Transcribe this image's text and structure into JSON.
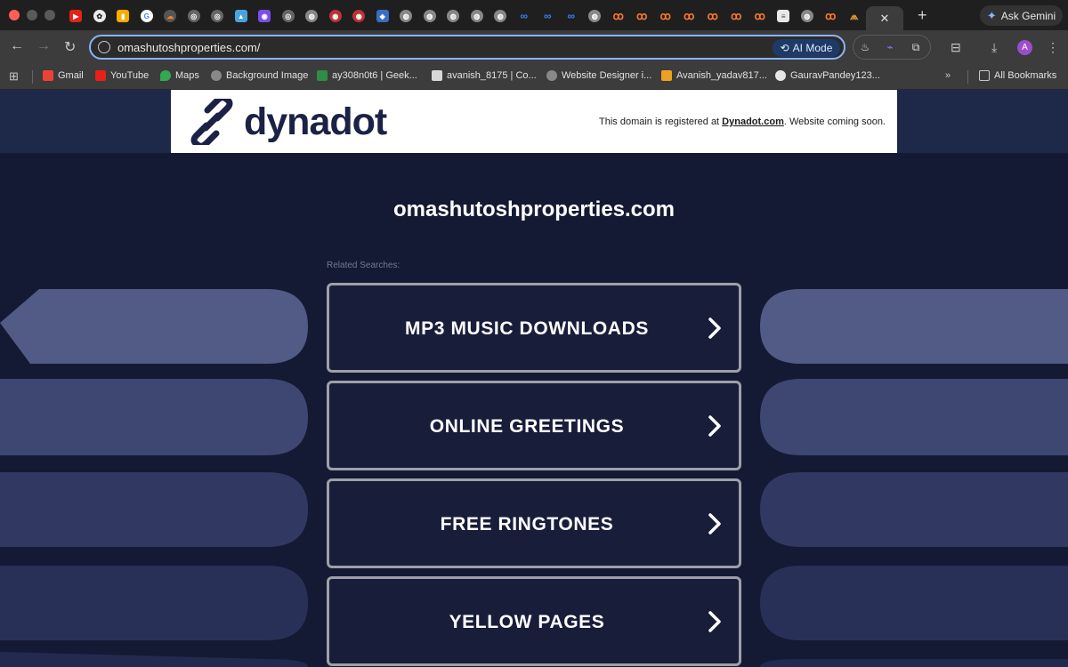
{
  "browser": {
    "url": "omashutoshproperties.com/",
    "ai_mode_label": "AI Mode",
    "gemini_label": "Ask Gemini",
    "avatar_initial": "A",
    "bookmarks": [
      {
        "label": "Gmail",
        "icon": "gmail-icon"
      },
      {
        "label": "YouTube",
        "icon": "youtube-icon"
      },
      {
        "label": "Maps",
        "icon": "maps-icon"
      },
      {
        "label": "Background Image",
        "icon": "globe-icon"
      },
      {
        "label": "ay308n0t6 | Geek...",
        "icon": "geeksforgeeks-icon"
      },
      {
        "label": "avanish_8175 | Co...",
        "icon": "codechef-icon"
      },
      {
        "label": "Website Designer i...",
        "icon": "globe-icon"
      },
      {
        "label": "Avanish_yadav817...",
        "icon": "leetcode-icon"
      },
      {
        "label": "GauravPandey123...",
        "icon": "github-icon"
      }
    ],
    "all_bookmarks_label": "All Bookmarks"
  },
  "page": {
    "brand_name": "dynadot",
    "notice_prefix": "This domain is registered at ",
    "notice_link": "Dynadot.com",
    "notice_suffix": ". Website coming soon.",
    "domain": "omashutoshproperties.com",
    "related_label": "Related Searches:",
    "searches": [
      "MP3 MUSIC DOWNLOADS",
      "ONLINE GREETINGS",
      "FREE RINGTONES",
      "YELLOW PAGES"
    ]
  }
}
